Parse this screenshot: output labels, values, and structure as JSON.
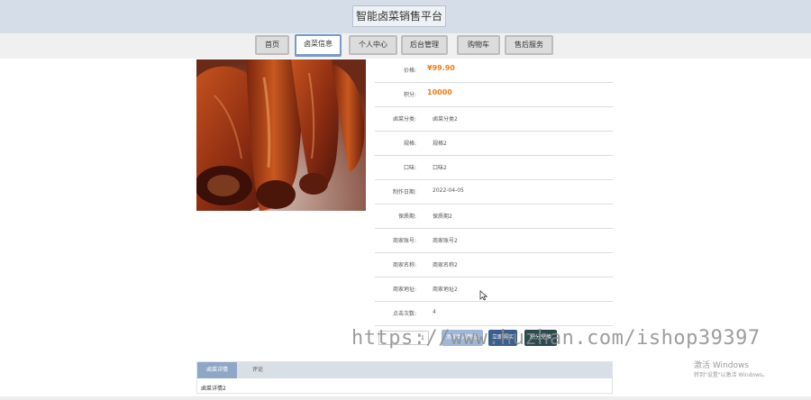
{
  "site": {
    "title": "智能卤菜销售平台"
  },
  "nav": {
    "items": [
      {
        "label": "首页"
      },
      {
        "label": "卤菜信息"
      },
      {
        "label": "个人中心"
      },
      {
        "label": "后台管理"
      },
      {
        "label": "购物车"
      },
      {
        "label": "售后服务"
      }
    ]
  },
  "product": {
    "price_label": "价格:",
    "price_value": "¥99.90",
    "points_label": "积分:",
    "points_value": "10000",
    "fields": [
      {
        "label": "卤菜分类:",
        "value": "卤菜分类2"
      },
      {
        "label": "规格:",
        "value": "规格2"
      },
      {
        "label": "口味:",
        "value": "口味2"
      },
      {
        "label": "制作日期:",
        "value": "2022-04-05"
      },
      {
        "label": "保质期:",
        "value": "保质期2"
      },
      {
        "label": "商家账号:",
        "value": "商家账号2"
      },
      {
        "label": "商家名称:",
        "value": "商家名称2"
      },
      {
        "label": "商家地址:",
        "value": "商家地址2"
      },
      {
        "label": "点击次数:",
        "value": "4"
      }
    ]
  },
  "actions": {
    "quantity": "1",
    "add_cart": "添加到购物车",
    "buy_now": "立即购买",
    "points_redeem": "积分兑换"
  },
  "tabs": {
    "items": [
      {
        "label": "卤菜详情"
      },
      {
        "label": "评论"
      }
    ],
    "detail": "卤菜详情2"
  },
  "overlay": {
    "watermark": "https://www.huzhan.com/ishop39397",
    "win_title": "激活 Windows",
    "win_sub": "转到\"设置\"以激活 Windows。"
  },
  "colors": {
    "accent": "#8fa7c6",
    "price": "#f07c1a",
    "buy_button": "#3a5f8f",
    "redeem_button": "#2b4a4f"
  }
}
